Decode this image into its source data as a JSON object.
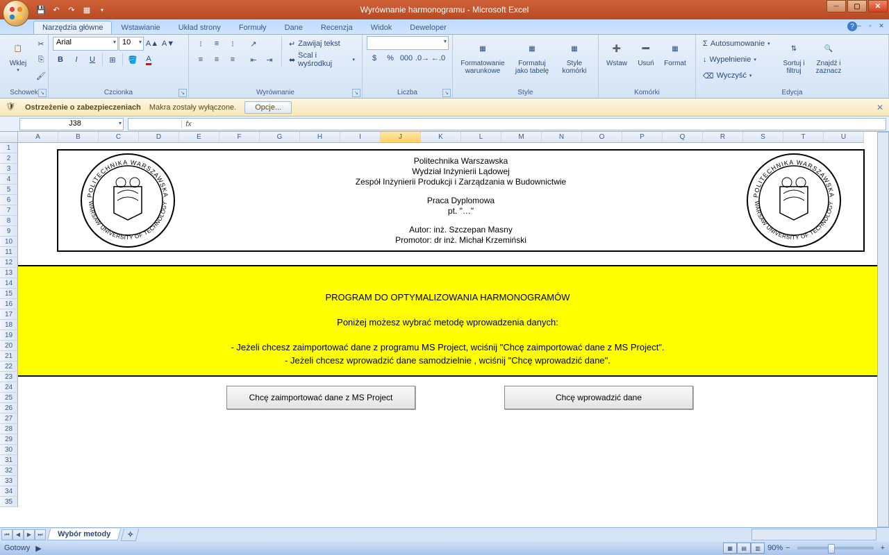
{
  "title": "Wyrównanie harmonogramu - Microsoft Excel",
  "tabs": {
    "home": "Narzędzia główne",
    "insert": "Wstawianie",
    "layout": "Układ strony",
    "formulas": "Formuły",
    "data": "Dane",
    "review": "Recenzja",
    "view": "Widok",
    "developer": "Deweloper"
  },
  "ribbon": {
    "clipboard": {
      "label": "Schowek",
      "paste": "Wklej"
    },
    "font": {
      "label": "Czcionka",
      "name": "Arial",
      "size": "10"
    },
    "alignment": {
      "label": "Wyrównanie",
      "wrap": "Zawijaj tekst",
      "merge": "Scal i wyśrodkuj"
    },
    "number": {
      "label": "Liczba"
    },
    "styles": {
      "label": "Style",
      "cond": "Formatowanie warunkowe",
      "table": "Formatuj jako tabelę",
      "cell": "Style komórki"
    },
    "cells": {
      "label": "Komórki",
      "insert": "Wstaw",
      "delete": "Usuń",
      "format": "Format"
    },
    "editing": {
      "label": "Edycja",
      "sum": "Autosumowanie",
      "fill": "Wypełnienie",
      "clear": "Wyczyść",
      "sort": "Sortuj i filtruj",
      "find": "Znajdź i zaznacz"
    }
  },
  "security": {
    "title": "Ostrzeżenie o zabezpieczeniach",
    "msg": "Makra zostały wyłączone.",
    "opts": "Opcje..."
  },
  "namebox": "J38",
  "columns": [
    "A",
    "B",
    "C",
    "D",
    "E",
    "F",
    "G",
    "H",
    "I",
    "J",
    "K",
    "L",
    "M",
    "N",
    "O",
    "P",
    "Q",
    "R",
    "S",
    "T",
    "U"
  ],
  "selected_col": "J",
  "rows_count": 35,
  "doc": {
    "uni": "Politechnika Warszawska",
    "faculty": "Wydział Inżynierii Lądowej",
    "dept": "Zespół Inżynierii Produkcji i Zarządzania w Budownictwie",
    "thesis": "Praca Dyplomowa",
    "pt": "pt. \"…\"",
    "author": "Autor: inż. Szczepan Masny",
    "promoter": "Promotor: dr inż. Michał Krzemiński",
    "seal_top": "POLITECHNIKA WARSZAWSKA",
    "seal_bottom": "WARSAW UNIVERSITY OF TECHNOLOGY"
  },
  "yellow": {
    "title": "PROGRAM DO OPTYMALIZOWANIA HARMONOGRAMÓW",
    "line1": "Poniżej możesz wybrać metodę wprowadzenia danych:",
    "line2": "- Jeżeli chcesz zaimportować dane z programu MS Project, wciśnij \"Chcę zaimportować dane z MS Project\".",
    "line3": "- Jeżeli chcesz wprowadzić dane samodzielnie , wciśnij \"Chcę wprowadzić dane\"."
  },
  "buttons": {
    "import": "Chcę zaimportować dane z MS Project",
    "manual": "Chcę wprowadzić dane"
  },
  "sheet_tab": "Wybór metody",
  "status": {
    "ready": "Gotowy",
    "zoom": "90%"
  }
}
